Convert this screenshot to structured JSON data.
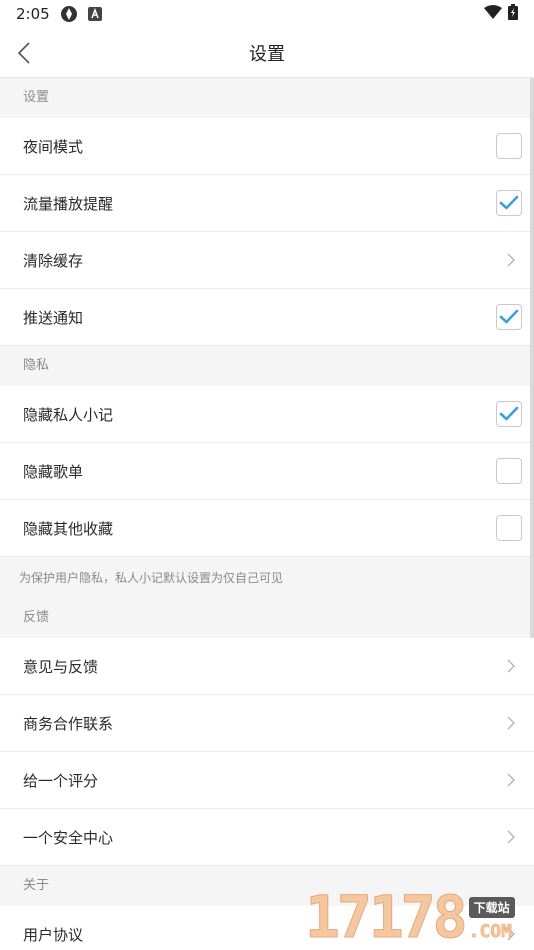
{
  "status_bar": {
    "time": "2:05"
  },
  "header": {
    "title": "设置"
  },
  "sections": [
    {
      "header": "设置",
      "rows": [
        {
          "label": "夜间模式",
          "control": "checkbox",
          "checked": false
        },
        {
          "label": "流量播放提醒",
          "control": "checkbox",
          "checked": true
        },
        {
          "label": "清除缓存",
          "control": "chevron"
        },
        {
          "label": "推送通知",
          "control": "checkbox",
          "checked": true
        }
      ]
    },
    {
      "header": "隐私",
      "rows": [
        {
          "label": "隐藏私人小记",
          "control": "checkbox",
          "checked": true
        },
        {
          "label": "隐藏歌单",
          "control": "checkbox",
          "checked": false
        },
        {
          "label": "隐藏其他收藏",
          "control": "checkbox",
          "checked": false
        }
      ],
      "note": "为保护用户隐私，私人小记默认设置为仅自己可见"
    },
    {
      "header": "反馈",
      "rows": [
        {
          "label": "意见与反馈",
          "control": "chevron"
        },
        {
          "label": "商务合作联系",
          "control": "chevron"
        },
        {
          "label": "给一个评分",
          "control": "chevron"
        },
        {
          "label": "一个安全中心",
          "control": "chevron"
        }
      ]
    },
    {
      "header": "关于",
      "rows": [
        {
          "label": "用户协议",
          "control": "chevron"
        }
      ]
    }
  ],
  "watermark": {
    "number": "17178",
    "badge": "下载站",
    "domain": ".COM"
  },
  "colors": {
    "check": "#3aa1e0",
    "accent": "#3aa1e0"
  }
}
